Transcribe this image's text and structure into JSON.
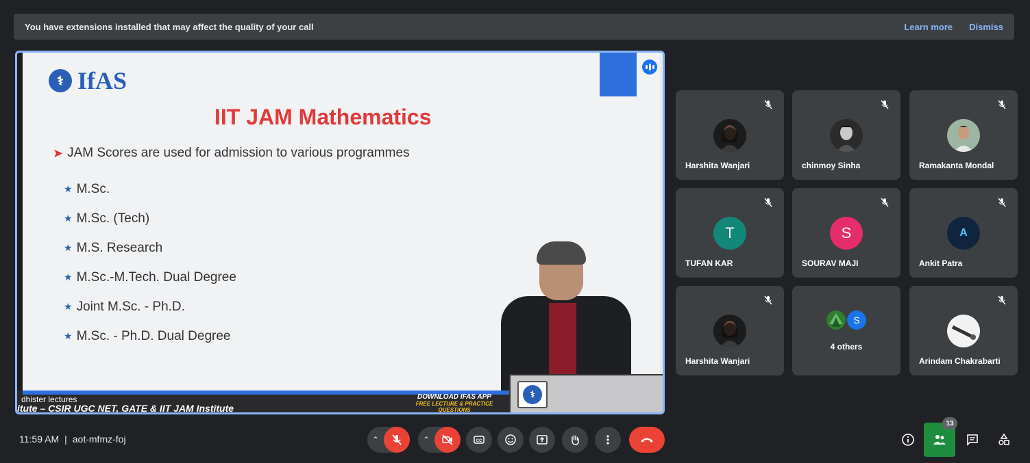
{
  "banner": {
    "message": "You have extensions installed that may affect the quality of your call",
    "learn_more": "Learn more",
    "dismiss": "Dismiss"
  },
  "presentation": {
    "logo_text": "IfAS",
    "title": "IIT JAM Mathematics",
    "main_bullet": "JAM Scores are used for admission to various programmes",
    "sub_bullets": [
      "M.Sc.",
      "M.Sc. (Tech)",
      "M.S. Research",
      "M.Sc.-M.Tech. Dual Degree",
      "Joint M.Sc. - Ph.D.",
      "M.Sc. - Ph.D. Dual Degree"
    ],
    "caption_name": "dhister lectures",
    "ticker": "itute – CSIR UGC NET, GATE & IIT JAM Institute",
    "app_line1": "DOWNLOAD IFAS APP",
    "app_line2": "FREE LECTURE & PRACTICE QUESTIONS"
  },
  "participants": [
    {
      "name": "Harshita Wanjari",
      "avatar": "photo-dark",
      "initial": ""
    },
    {
      "name": "chinmoy Sinha",
      "avatar": "photo-dark",
      "initial": ""
    },
    {
      "name": "Ramakanta Mondal",
      "avatar": "photo-light",
      "initial": ""
    },
    {
      "name": "TUFAN KAR",
      "avatar": "initial",
      "initial": "T",
      "color": "#12877a"
    },
    {
      "name": "SOURAV MAJI",
      "avatar": "initial",
      "initial": "S",
      "color": "#e52d6b"
    },
    {
      "name": "Ankit Patra",
      "avatar": "logo",
      "initial": "A",
      "color": "#10243f"
    },
    {
      "name": "Harshita Wanjari",
      "avatar": "photo-dark",
      "initial": ""
    },
    {
      "name": "4 others",
      "avatar": "group",
      "initial": "S",
      "color": "#1a73e8"
    },
    {
      "name": "Arindam Chakrabarti",
      "avatar": "photo-light",
      "initial": ""
    }
  ],
  "footer": {
    "time": "11:59 AM",
    "separator": "|",
    "meeting_code": "aot-mfmz-foj",
    "participant_count": "13"
  },
  "colors": {
    "accent_blue": "#8ab4f8",
    "danger_red": "#ea4335",
    "active_green": "#1e8e3e"
  }
}
